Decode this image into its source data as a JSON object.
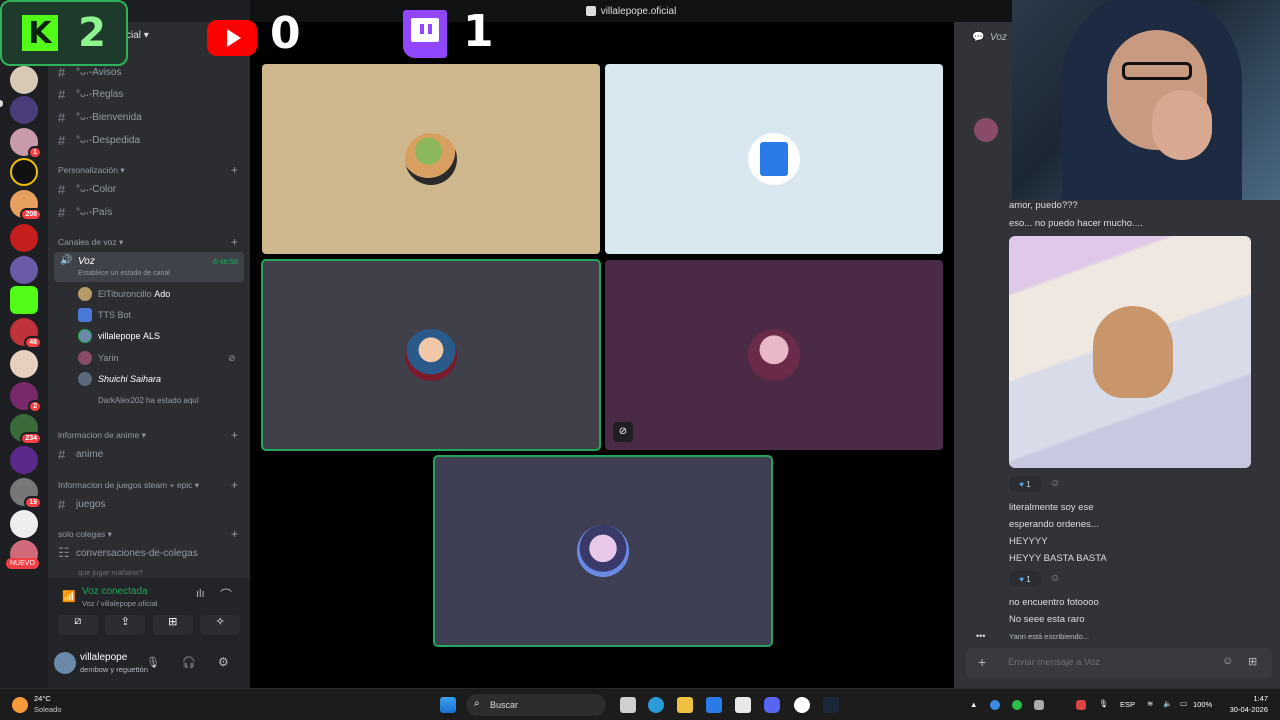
{
  "window": {
    "title": "villalepope.oficial"
  },
  "overlay": {
    "kick_letter": "K",
    "kick_count": "2",
    "youtube_count": "0",
    "twitch_count": "1"
  },
  "server_rail": {
    "badges": [
      "1",
      "208",
      "48",
      "2",
      "234",
      "19"
    ],
    "nuevo_label": "NUEVO"
  },
  "sidebar": {
    "server_name_partial": "cial",
    "channels_top": [
      "°ᴗ˖-Avisos",
      "°ᴗ˖-Reglas",
      "°ᴗ˖-Bienvenida",
      "°ᴗ˖-Despedida"
    ],
    "cat_personalizacion": "Personalización",
    "channels_personalizacion": [
      "°ᴗ˖-Color",
      "°ᴗ˖-País"
    ],
    "cat_voz": "Canales de voz",
    "voice_channel": {
      "name": "Voz",
      "timer": "6:48:58",
      "status": "Establece un estado de canal"
    },
    "voice_users": [
      {
        "name": "ElTiburoncillo",
        "tag": "Ado"
      },
      {
        "name": "TTS Bot",
        "tag": ""
      },
      {
        "name": "villalepope",
        "tag": "ALS"
      },
      {
        "name": "Yarin",
        "tag": ""
      },
      {
        "name": "Shuichi Saihara",
        "tag": ""
      },
      {
        "name": "DarkAlex202 ha estado aquí",
        "tag": ""
      }
    ],
    "cat_anime": "informacion de anime",
    "chan_anime": "anime",
    "cat_juegos": "Informacion de juegos steam + epic",
    "chan_juegos": "juegos",
    "cat_colegas": "solo colegas",
    "chan_colegas": "conversaciones-de-colegas",
    "chan_colegas_sub": "que jugar mañana?"
  },
  "voice_panel": {
    "status": "Voz conectada",
    "location": "Voz / villalepope.oficial",
    "user_name": "villalepope",
    "user_status": "dembow y reguettón"
  },
  "chat": {
    "header": "Voz",
    "messages": [
      "amor, puedo???",
      "eso... no puedo hacer mucho....",
      "literalmente soy ese",
      "esperando ordenes...",
      "HEYYYY",
      "HEYYY BASTA BASTA",
      "no encuentro fotoooo",
      "No seee esta raro"
    ],
    "reaction_count_1": "1",
    "reaction_count_2": "1",
    "typing": "Yann está escribiendo...",
    "input_placeholder": "Enviar mensaje a Voz"
  },
  "taskbar": {
    "weather_temp": "24°C",
    "weather_desc": "Soleado",
    "search": "Buscar",
    "lang": "ESP",
    "battery": "100%",
    "time": "1:47",
    "date": "30-04-2026"
  },
  "colors": {
    "discord_bg": "#313338",
    "sidebar_bg": "#2b2d31",
    "speaking": "#23a55a",
    "kick": "#53fc18",
    "youtube": "#ff0000",
    "twitch": "#9146ff"
  }
}
